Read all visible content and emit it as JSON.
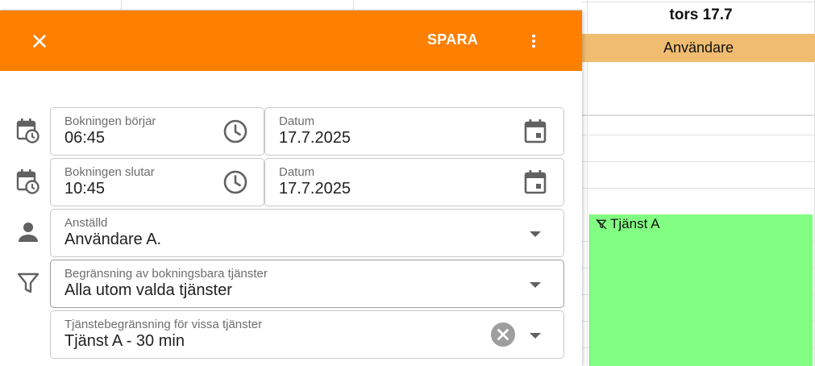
{
  "dialog": {
    "toolbar": {
      "close_icon": "close-icon",
      "save_label": "SPARA",
      "more_icon": "more-vert-icon",
      "color": "#ff7f00"
    },
    "start": {
      "row_icon": "calendar-clock-icon",
      "time_label": "Bokningen börjar",
      "time_value": "06:45",
      "time_icon": "clock-icon",
      "date_label": "Datum",
      "date_value": "17.7.2025",
      "date_icon": "calendar-icon"
    },
    "end": {
      "row_icon": "calendar-clock-icon",
      "time_label": "Bokningen slutar",
      "time_value": "10:45",
      "time_icon": "clock-icon",
      "date_label": "Datum",
      "date_value": "17.7.2025",
      "date_icon": "calendar-icon"
    },
    "employee": {
      "row_icon": "person-icon",
      "label": "Anställd",
      "value": "Användare A.",
      "dropdown_icon": "arrow-drop-down-icon"
    },
    "restriction": {
      "row_icon": "filter-icon",
      "label": "Begränsning av bokningsbara tjänster",
      "value": "Alla utom valda tjänster",
      "dropdown_icon": "arrow-drop-down-icon"
    },
    "services": {
      "label": "Tjänstebegränsning för vissa tjänster",
      "value": "Tjänst A - 30 min",
      "clear_icon": "clear-icon",
      "dropdown_icon": "arrow-drop-down-icon"
    }
  },
  "calendar": {
    "day_header": "tors 17.7",
    "resource_header": "Användare",
    "resource_color": "#f0bc70",
    "event": {
      "title": "Tjänst A",
      "icon": "filter-off-icon",
      "color": "#82ff82"
    }
  }
}
